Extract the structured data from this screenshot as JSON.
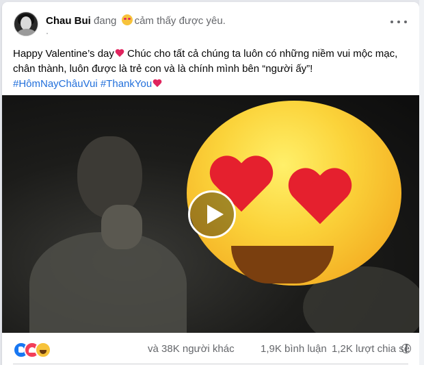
{
  "author": {
    "name": "Chau Bui",
    "feeling_prefix": "đang",
    "feeling_emoji": "smiling-face-with-hearts",
    "feeling_text": "cảm thấy được yêu.",
    "timestamp_separator": "·"
  },
  "post": {
    "text_part1": "Happy Valentine’s day",
    "text_emoji": "heart-icon",
    "text_part2": " Chúc cho tất cả chúng ta luôn có những niềm vui mộc mạc, chân thành, luôn được là trẻ con và là chính mình bên “người ấy”!",
    "hashtags": [
      "#HômNayChâuVui",
      "#ThankYou"
    ],
    "hashtag_emoji": "red-heart-icon"
  },
  "video": {
    "overlay_emoji": "heart-eyes-emoji",
    "control": "play-icon"
  },
  "stats": {
    "reaction_icons": [
      "like-icon",
      "love-icon",
      "haha-icon"
    ],
    "reactions": "và 38K người khác",
    "comments": "1,9K bình luận",
    "shares": "1,2K lượt chia sẻ"
  },
  "colors": {
    "link": "#216fdb",
    "like": "#1877f2",
    "love": "#f33e58",
    "haha": "#f7c33b"
  }
}
